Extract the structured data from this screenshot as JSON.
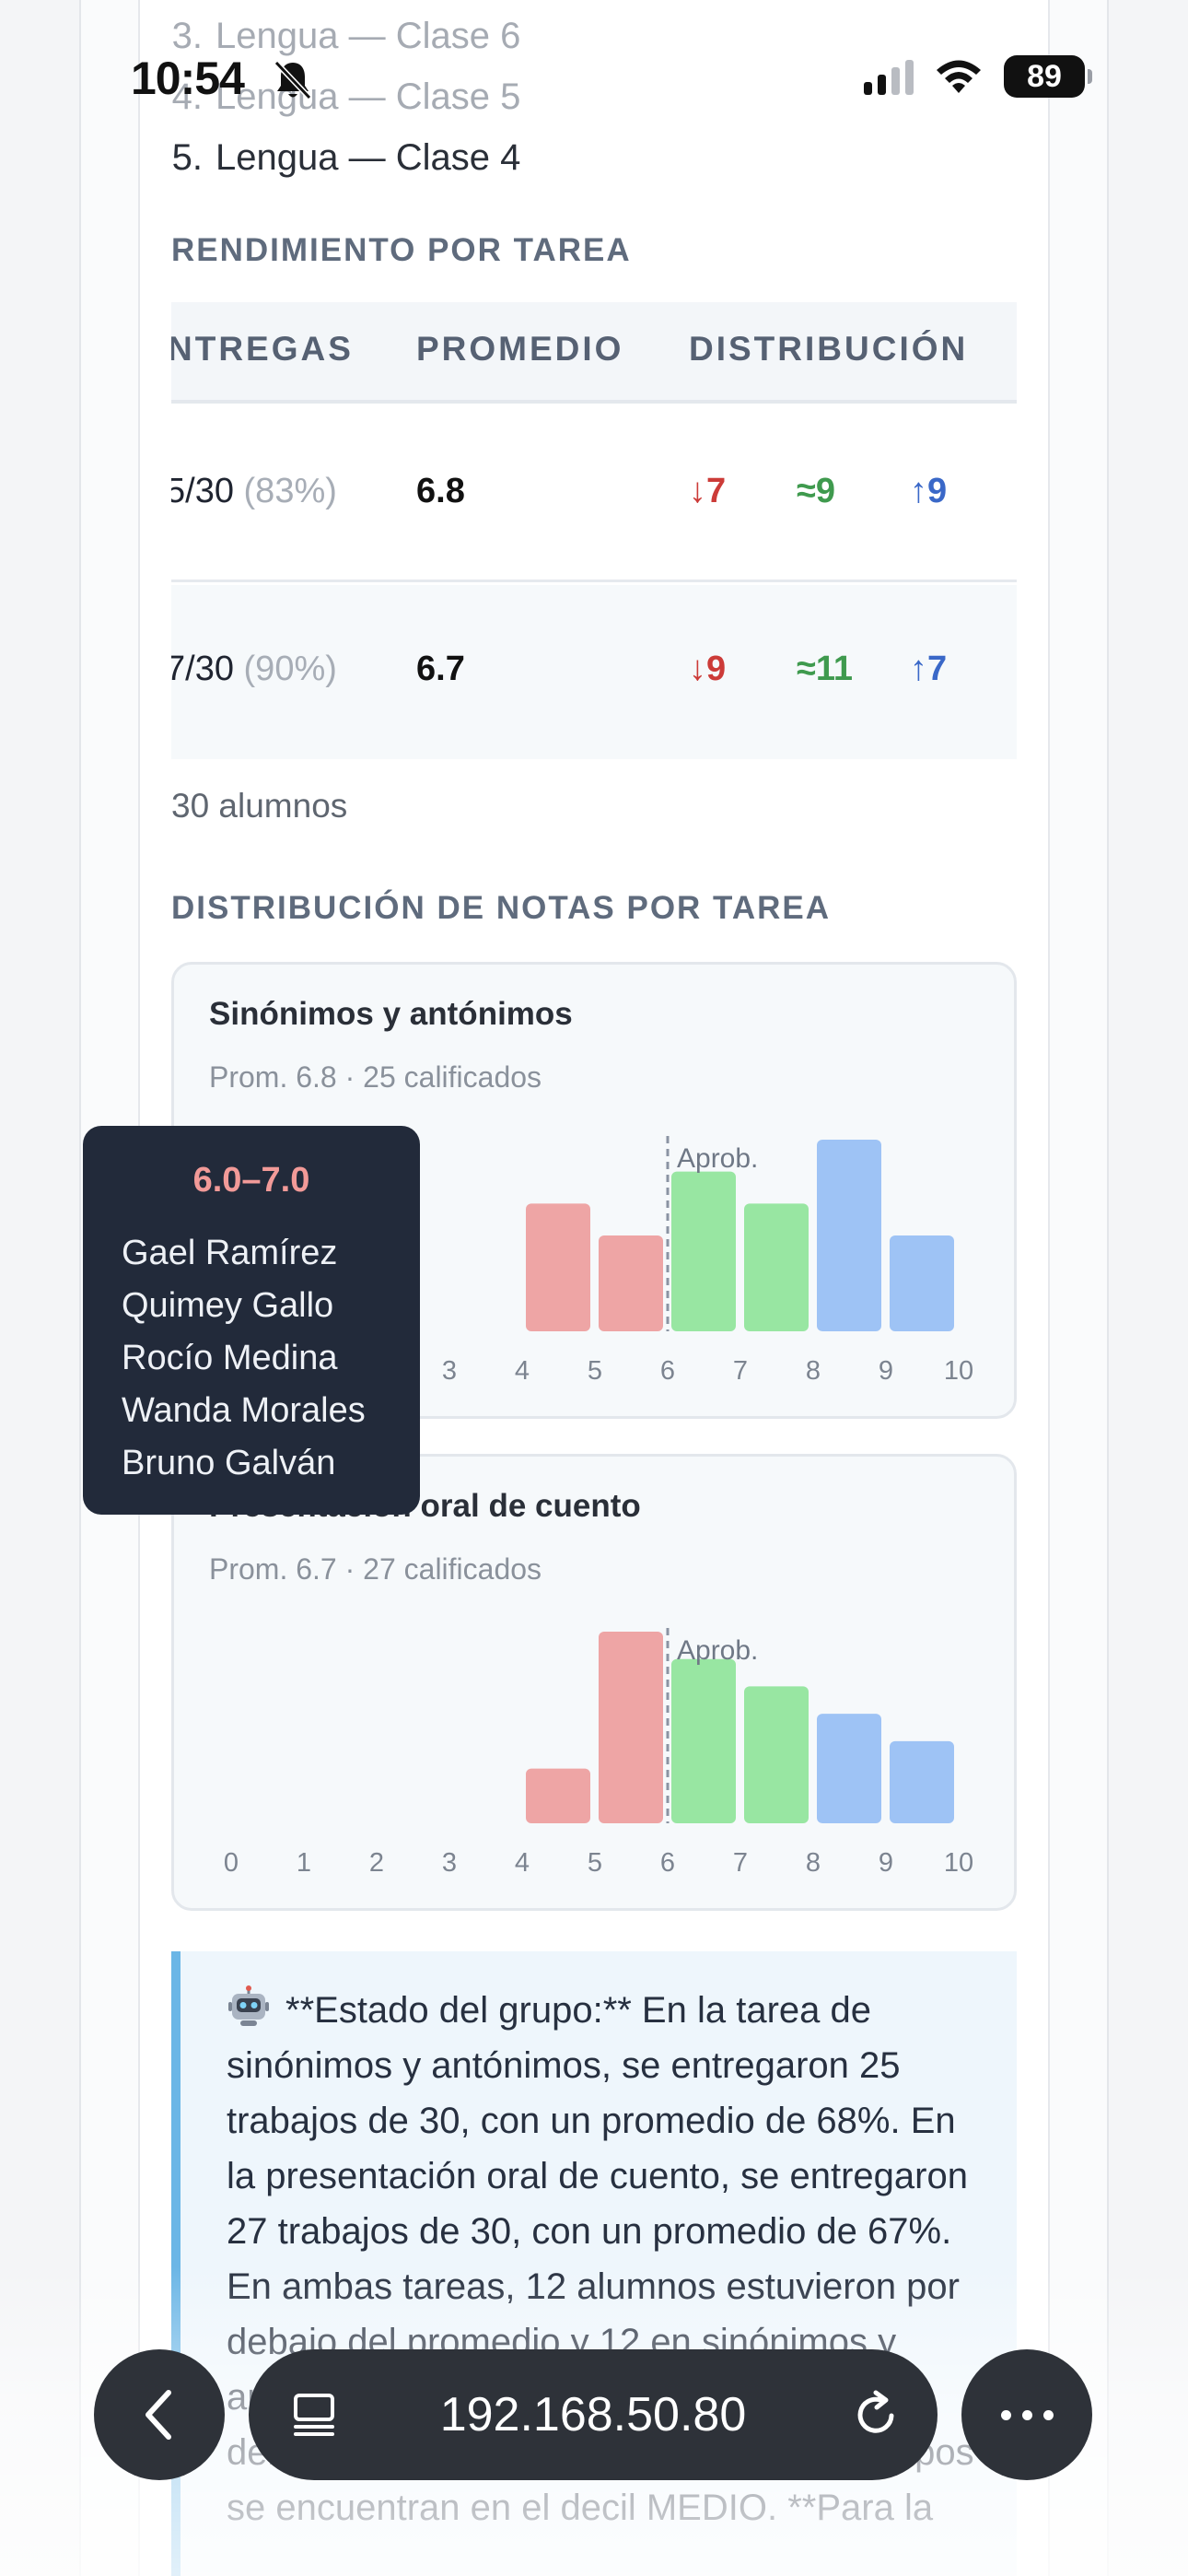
{
  "status_bar": {
    "time": "10:54",
    "battery": "89"
  },
  "top_list": [
    {
      "num": "3.",
      "label": "Lengua — Clase 6"
    },
    {
      "num": "4.",
      "label": "Lengua — Clase 5"
    },
    {
      "num": "5.",
      "label": "Lengua — Clase 4"
    }
  ],
  "performance": {
    "title": "RENDIMIENTO POR TAREA",
    "headers": [
      "NTREGAS",
      "PROMEDIO",
      "DISTRIBUCIÓN"
    ],
    "rows": [
      {
        "entregas": "5/30",
        "pct": "(83%)",
        "promedio": "6.8",
        "low": "↓7",
        "mid": "≈9",
        "high": "↑9"
      },
      {
        "entregas": "7/30",
        "pct": "(90%)",
        "promedio": "6.7",
        "low": "↓9",
        "mid": "≈11",
        "high": "↑7"
      }
    ],
    "note": "30 alumnos"
  },
  "distribution_title": "DISTRIBUCIÓN DE NOTAS POR TAREA",
  "colors": {
    "fail": "#eea5a5",
    "pass": "#98e6a2",
    "high": "#9ec3f5",
    "tooltip_bg": "#222a3a",
    "accent": "#6bb6e6"
  },
  "chart_data": [
    {
      "type": "bar",
      "title": "Sinónimos y antónimos",
      "subtitle": "Prom. 6.8 · 25 calificados",
      "xlabel": "",
      "ylabel": "",
      "x_ticks": [
        "0",
        "1",
        "2",
        "3",
        "4",
        "5",
        "6",
        "7",
        "8",
        "9",
        "10"
      ],
      "categories": [
        "4",
        "5",
        "6",
        "7",
        "8",
        "9"
      ],
      "values": [
        4,
        3,
        5,
        4,
        6,
        3
      ],
      "threshold": {
        "value": 6,
        "label": "Aprob."
      },
      "ylim": [
        0,
        6
      ]
    },
    {
      "type": "bar",
      "title": "Presentación oral de cuento",
      "subtitle": "Prom. 6.7 · 27 calificados",
      "xlabel": "",
      "ylabel": "",
      "x_ticks": [
        "0",
        "1",
        "2",
        "3",
        "4",
        "5",
        "6",
        "7",
        "8",
        "9",
        "10"
      ],
      "categories": [
        "4",
        "5",
        "6",
        "7",
        "8",
        "9"
      ],
      "values": [
        2,
        7,
        6,
        5,
        4,
        3
      ],
      "threshold": {
        "value": 6,
        "label": "Aprob."
      },
      "ylim": [
        0,
        7
      ]
    }
  ],
  "tooltip": {
    "range": "6.0–7.0",
    "names": [
      "Gael Ramírez",
      "Quimey Gallo",
      "Rocío Medina",
      "Wanda Morales",
      "Bruno Galván"
    ]
  },
  "summary": {
    "icon": "robot-icon",
    "text": "**Estado del grupo:** En la tarea de sinónimos y antónimos, se entregaron 25 trabajos de 30, con un promedio de 68%. En la presentación oral de cuento, se entregaron 27 trabajos de 30, con un promedio de 67%. En ambas tareas, 12 alumnos estuvieron por debajo del promedio y 12 en sinónimos y antónimos, mientras que 13 estuvieron por debajo en la presentación oral; ambos grupos se encuentran en el decil MEDIO. **Para la"
  },
  "browser": {
    "url": "192.168.50.80"
  }
}
